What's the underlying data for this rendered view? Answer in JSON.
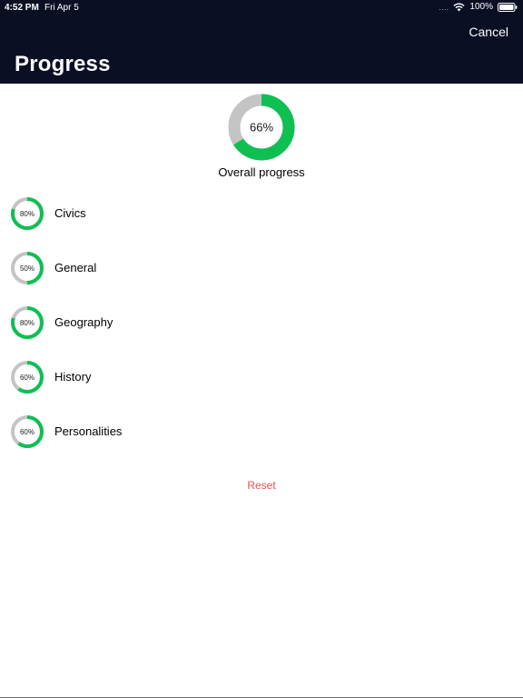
{
  "status_bar": {
    "time": "4:52 PM",
    "date": "Fri Apr 5",
    "signal": "....",
    "battery": "100%",
    "icons": [
      "wifi-icon",
      "battery-icon"
    ]
  },
  "header": {
    "cancel_label": "Cancel",
    "title": "Progress"
  },
  "overall": {
    "percent_label": "66%",
    "value": 66,
    "label": "Overall progress"
  },
  "categories": [
    {
      "name": "Civics",
      "percent_label": "80%",
      "value": 80
    },
    {
      "name": "General",
      "percent_label": "50%",
      "value": 50
    },
    {
      "name": "Geography",
      "percent_label": "80%",
      "value": 80
    },
    {
      "name": "History",
      "percent_label": "60%",
      "value": 60
    },
    {
      "name": "Personalities",
      "percent_label": "60%",
      "value": 60
    }
  ],
  "reset_label": "Reset",
  "colors": {
    "header_bg": "#0b0f24",
    "progress": "#0fbf52",
    "track": "#c4c4c4",
    "reset": "#e5534b"
  }
}
